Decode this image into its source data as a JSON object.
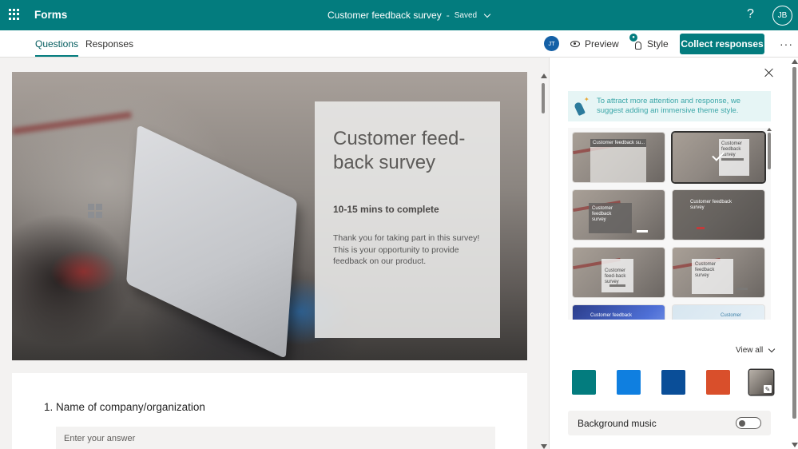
{
  "topbar": {
    "app_name": "Forms",
    "form_title": "Customer feedback survey",
    "separator": "-",
    "save_status": "Saved",
    "help_label": "?",
    "user_initials": "JB",
    "bg_color": "#037c7e"
  },
  "command_bar": {
    "tabs": [
      {
        "label": "Questions",
        "active": true
      },
      {
        "label": "Responses",
        "active": false
      }
    ],
    "collaborator_initials": "JT",
    "preview_label": "Preview",
    "style_label": "Style",
    "collect_label": "Collect responses",
    "more_label": "···"
  },
  "form": {
    "title": "Customer feed-back survey",
    "duration": "10-15 mins to complete",
    "description": "Thank you for taking part in this survey! This is your opportunity to provide feedback on our product.",
    "questions": [
      {
        "number": "1.",
        "title": "Name of company/organization",
        "placeholder": "Enter your answer"
      }
    ]
  },
  "style_panel": {
    "tip": "To attract more attention and response, we suggest adding an immersive theme style.",
    "themes": [
      {
        "label": "Customer feedback su...",
        "style": "dark-header"
      },
      {
        "label": "Customer feedback survey",
        "style": "light-card",
        "selected": true
      },
      {
        "label": "Customer feedback survey",
        "style": "dark-card"
      },
      {
        "label": "Customer feedback survey",
        "style": "overlay"
      },
      {
        "label": "Customer feed-back survey",
        "style": "center-card"
      },
      {
        "label": "Customer feedback survey",
        "style": "light-card-right"
      },
      {
        "label": "Customer feedback",
        "style": "blue"
      },
      {
        "label": "Customer",
        "style": "sky"
      }
    ],
    "view_all_label": "View all",
    "colors": [
      "#037c7e",
      "#0f7fe0",
      "#0a4e98",
      "#d94f2b"
    ],
    "background_music_label": "Background music",
    "background_music_on": false
  }
}
